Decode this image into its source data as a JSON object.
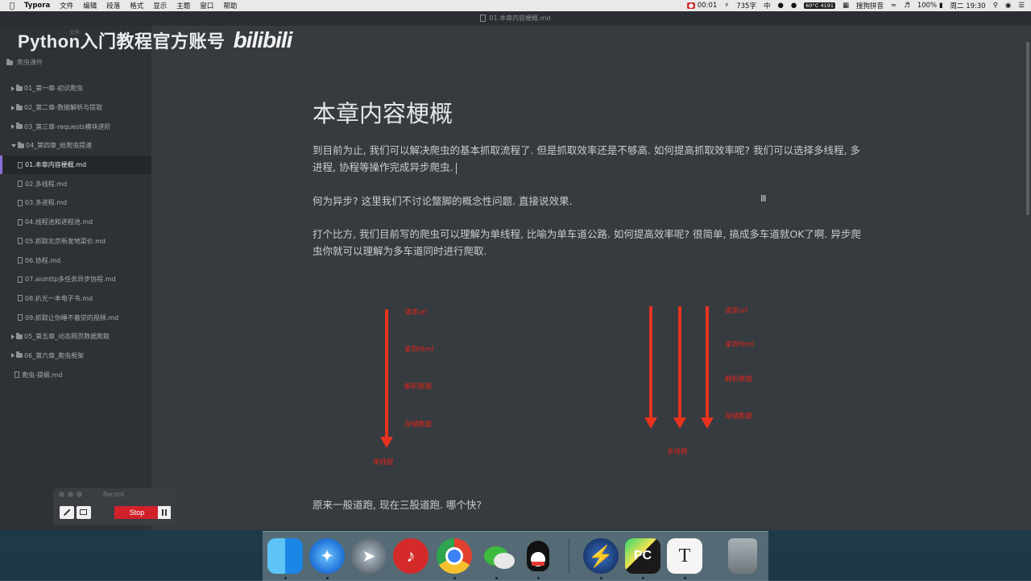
{
  "menubar": {
    "app_name": "Typora",
    "menus": [
      "文件",
      "编辑",
      "段落",
      "格式",
      "显示",
      "主题",
      "窗口",
      "帮助"
    ],
    "recording_time": "00:01",
    "word_count": "735字",
    "input_lang": "中",
    "temp": "60°C",
    "fan": "4191",
    "ime_name": "搜狗拼音",
    "battery": "100%",
    "datetime": "周二 19:30"
  },
  "window": {
    "title": "01.本章内容梗概.md"
  },
  "watermark": {
    "text": "Python入门教程官方账号",
    "logo": "bilibili"
  },
  "sidebar": {
    "header": "文件",
    "root": "爬虫课件",
    "items": [
      {
        "label": "01_第一章-初识爬虫",
        "kind": "folder",
        "open": false
      },
      {
        "label": "02_第二章-数据解析与提取",
        "kind": "folder",
        "open": false
      },
      {
        "label": "03_第三章-requests模块进阶",
        "kind": "folder",
        "open": false
      },
      {
        "label": "04_第四章_给爬虫提速",
        "kind": "folder",
        "open": true
      },
      {
        "label": "01.本章内容梗概.md",
        "kind": "file",
        "active": true
      },
      {
        "label": "02.多线程.md",
        "kind": "file"
      },
      {
        "label": "03.多进程.md",
        "kind": "file"
      },
      {
        "label": "04.线程池和进程池.md",
        "kind": "file"
      },
      {
        "label": "05.抓取北京新发地菜价.md",
        "kind": "file"
      },
      {
        "label": "06.协程.md",
        "kind": "file"
      },
      {
        "label": "07.aiohttp多任务异步协程.md",
        "kind": "file"
      },
      {
        "label": "08.扒光一本电子书.md",
        "kind": "file"
      },
      {
        "label": "09.抓取让你睡不着觉的视频.md",
        "kind": "file"
      },
      {
        "label": "05_第五章_动态网页数据爬取",
        "kind": "folder",
        "open": false
      },
      {
        "label": "06_第六章_爬虫框架",
        "kind": "folder",
        "open": false
      },
      {
        "label": "爬虫-提纲.md",
        "kind": "rootfile"
      }
    ]
  },
  "document": {
    "title": "本章内容梗概",
    "p1": "到目前为止, 我们可以解决爬虫的基本抓取流程了. 但是抓取效率还是不够高. 如何提高抓取效率呢? 我们可以选择多线程, 多进程, 协程等操作完成异步爬虫.",
    "p2": "何为异步? 这里我们不讨论蹩脚的概念性问题. 直接说效果.",
    "p3": "打个比方, 我们目前写的爬虫可以理解为单线程, 比喻为单车道公路. 如何提高效率呢? 很简单, 搞成多车道就OK了啊. 异步爬虫你就可以理解为多车道同时进行爬取.",
    "p4": "原来一般道跑, 现在三股道跑. 哪个快?"
  },
  "diagram": {
    "single": {
      "steps": [
        "请求url",
        "拿到html",
        "解析数据",
        "存储数据"
      ],
      "label": "单线程"
    },
    "multi": {
      "steps": [
        "请求url",
        "拿到html",
        "解析数据",
        "存储数据"
      ],
      "label": "多线程"
    },
    "arrow_color": "#e8321e"
  },
  "record_panel": {
    "title": "Record",
    "stop_label": "Stop"
  },
  "dock": {
    "items": [
      "finder-icon",
      "safari-icon",
      "launchpad-icon",
      "netease-music-icon",
      "chrome-icon",
      "wechat-icon",
      "qq-icon",
      "bolt-icon",
      "pycharm-icon",
      "typora-icon",
      "trash-icon"
    ],
    "pycharm_label": "PC",
    "typora_label": "T"
  }
}
